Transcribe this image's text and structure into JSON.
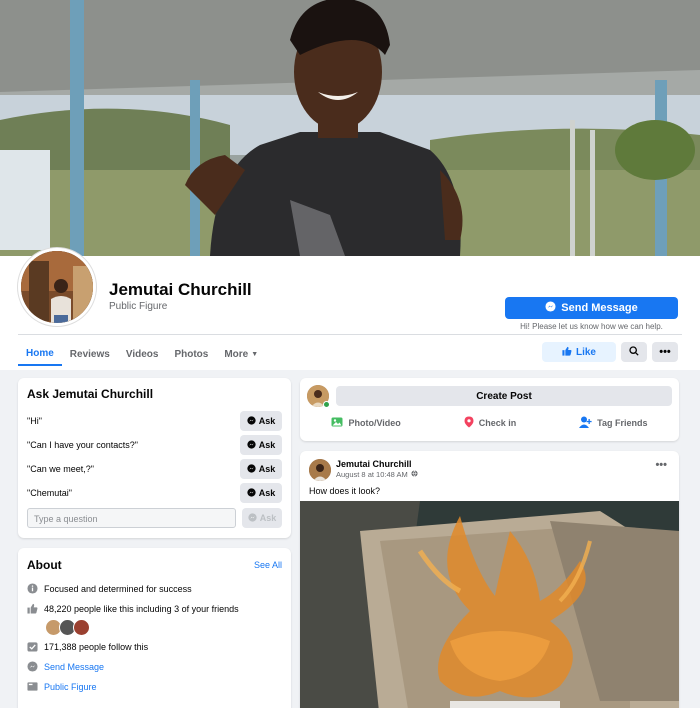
{
  "page": {
    "name": "Jemutai Churchill",
    "category": "Public Figure"
  },
  "header": {
    "send_message_label": "Send Message",
    "send_message_hint": "Hi! Please let us know how we can help.",
    "like_label": "Like",
    "more_label": "•••"
  },
  "tabs": [
    {
      "label": "Home",
      "active": true
    },
    {
      "label": "Reviews"
    },
    {
      "label": "Videos"
    },
    {
      "label": "Photos"
    },
    {
      "label": "More"
    }
  ],
  "ask": {
    "title": "Ask Jemutai Churchill",
    "questions": [
      {
        "text": "\"Hi\"",
        "button": "Ask"
      },
      {
        "text": "\"Can I have your contacts?\"",
        "button": "Ask"
      },
      {
        "text": "\"Can we meet,?\"",
        "button": "Ask"
      },
      {
        "text": "\"Chemutai\"",
        "button": "Ask"
      }
    ],
    "input_placeholder": "Type a question",
    "submit_label": "Ask"
  },
  "about": {
    "title": "About",
    "see_all": "See All",
    "rows": [
      {
        "icon": "info-icon",
        "text": "Focused and determined for success"
      },
      {
        "icon": "thumbs-up-icon",
        "text": "48,220 people like this including 3 of your friends"
      },
      {
        "icon": "follow-check-icon",
        "text": "171,388 people follow this"
      },
      {
        "icon": "messenger-icon",
        "text": "Send Message"
      },
      {
        "icon": "category-icon",
        "text": "Public Figure"
      }
    ]
  },
  "create_post": {
    "button": "Create Post",
    "actions": [
      {
        "icon": "photo-icon",
        "label": "Photo/Video"
      },
      {
        "icon": "location-pin-icon",
        "label": "Check in"
      },
      {
        "icon": "tag-friends-icon",
        "label": "Tag Friends"
      }
    ]
  },
  "post": {
    "author": "Jemutai Churchill",
    "time": "August 8 at 10:48 AM",
    "text": "How does it look?",
    "menu": "•••"
  },
  "colors": {
    "accent": "#1877f2",
    "background": "#f0f2f5",
    "online": "#31a24c"
  }
}
